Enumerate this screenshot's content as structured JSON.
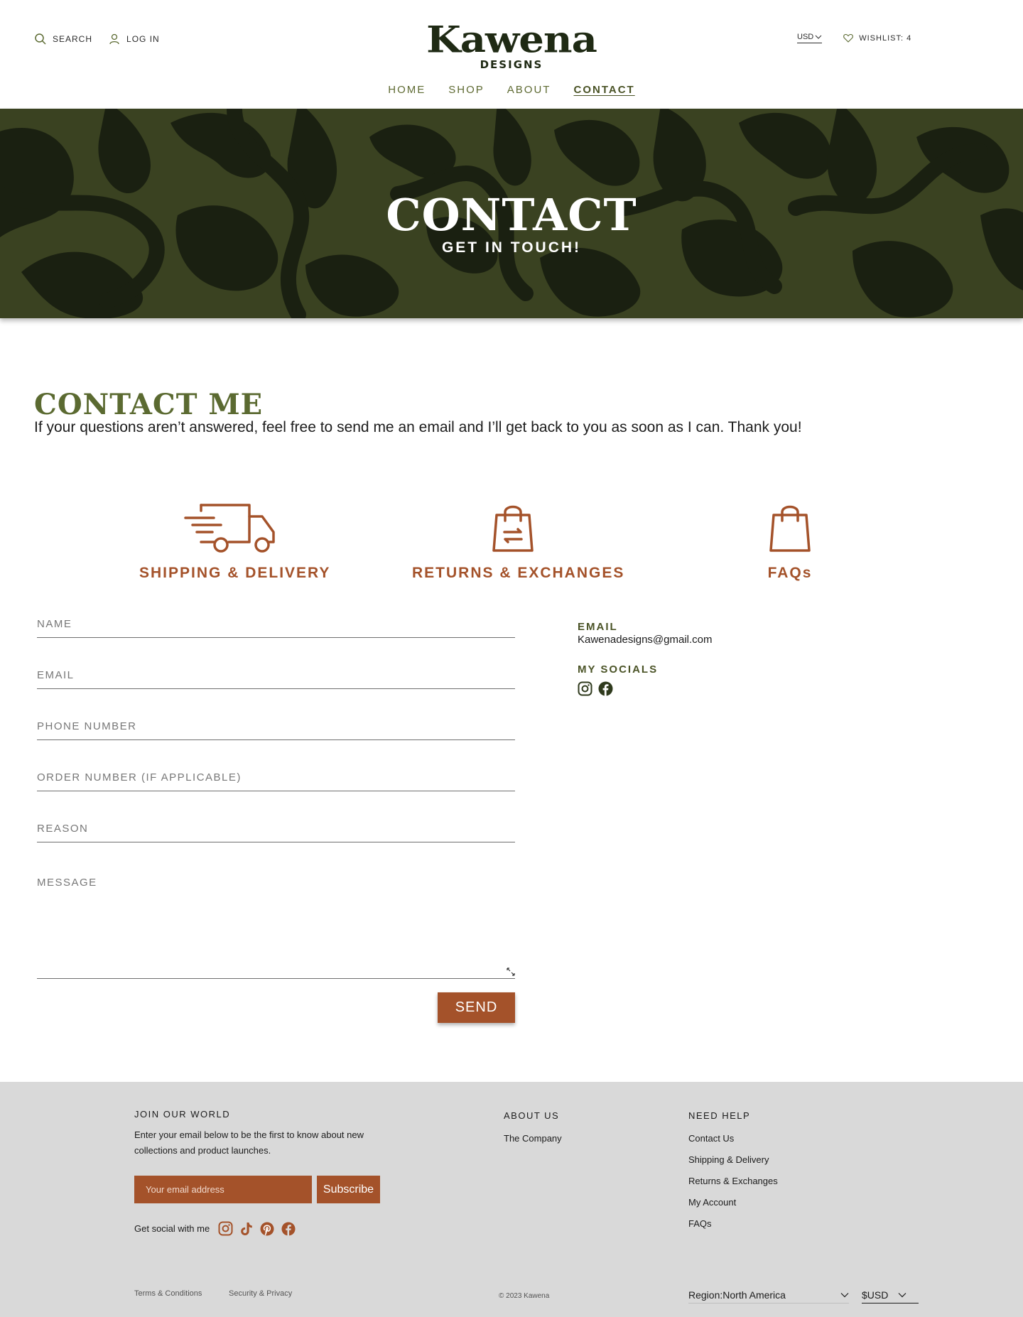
{
  "header": {
    "search_label": "SEARCH",
    "login_label": "LOG IN",
    "logo_word": "Kawena",
    "logo_sub": "DESIGNS",
    "currency": "USD",
    "wishlist_label": "WISHLIST: 4",
    "nav": [
      {
        "label": "HOME",
        "active": false
      },
      {
        "label": "SHOP",
        "active": false
      },
      {
        "label": "ABOUT",
        "active": false
      },
      {
        "label": "CONTACT",
        "active": true
      }
    ]
  },
  "hero": {
    "title": "CONTACT",
    "subtitle": "GET IN TOUCH!"
  },
  "contact": {
    "title": "CONTACT ME",
    "intro": "If your questions aren’t answered, feel free to send me an email and I’ll get back to you as soon as I can.  Thank you!"
  },
  "cards": [
    {
      "label": "SHIPPING & DELIVERY",
      "icon": "delivery-truck-icon"
    },
    {
      "label": "RETURNS & EXCHANGES",
      "icon": "shopping-bag-exchange-icon"
    },
    {
      "label": "FAQs",
      "icon": "shopping-bag-icon"
    }
  ],
  "form": {
    "name_placeholder": "NAME",
    "email_placeholder": "EMAIL",
    "phone_placeholder": "PHONE NUMBER",
    "order_placeholder": "ORDER NUMBER (IF APPLICABLE)",
    "reason_placeholder": "REASON",
    "message_placeholder": "MESSAGE",
    "send_label": "SEND"
  },
  "side": {
    "email_label": "EMAIL",
    "email_value": "Kawenadesigns@gmail.com",
    "socials_label": "MY SOCIALS",
    "social_icons": [
      "instagram-icon",
      "facebook-icon"
    ]
  },
  "footer": {
    "join_title": "JOIN OUR WORLD",
    "join_text": "Enter your email below to be the first to know about new collections and product launches.",
    "email_placeholder": "Your email address",
    "subscribe_label": "Subscribe",
    "social_label": "Get social with me",
    "social_icons": [
      "instagram-icon",
      "tiktok-icon",
      "pinterest-icon",
      "facebook-icon"
    ],
    "about_title": "ABOUT US",
    "about_links": [
      "The Company"
    ],
    "help_title": "NEED HELP",
    "help_links": [
      "Contact Us",
      "Shipping & Delivery",
      "Returns & Exchanges",
      "My Account",
      "FAQs"
    ],
    "terms_label": "Terms & Conditions",
    "security_label": "Security & Privacy",
    "copyright": "© 2023 Kawena",
    "region_label": "Region:North America",
    "currency_label": "$USD"
  },
  "colors": {
    "brand_dark": "#1f2a14",
    "olive": "#5b6a31",
    "rust": "#a4522a",
    "hero_bg": "#3a4221",
    "footer_bg": "#d9d9d9"
  }
}
